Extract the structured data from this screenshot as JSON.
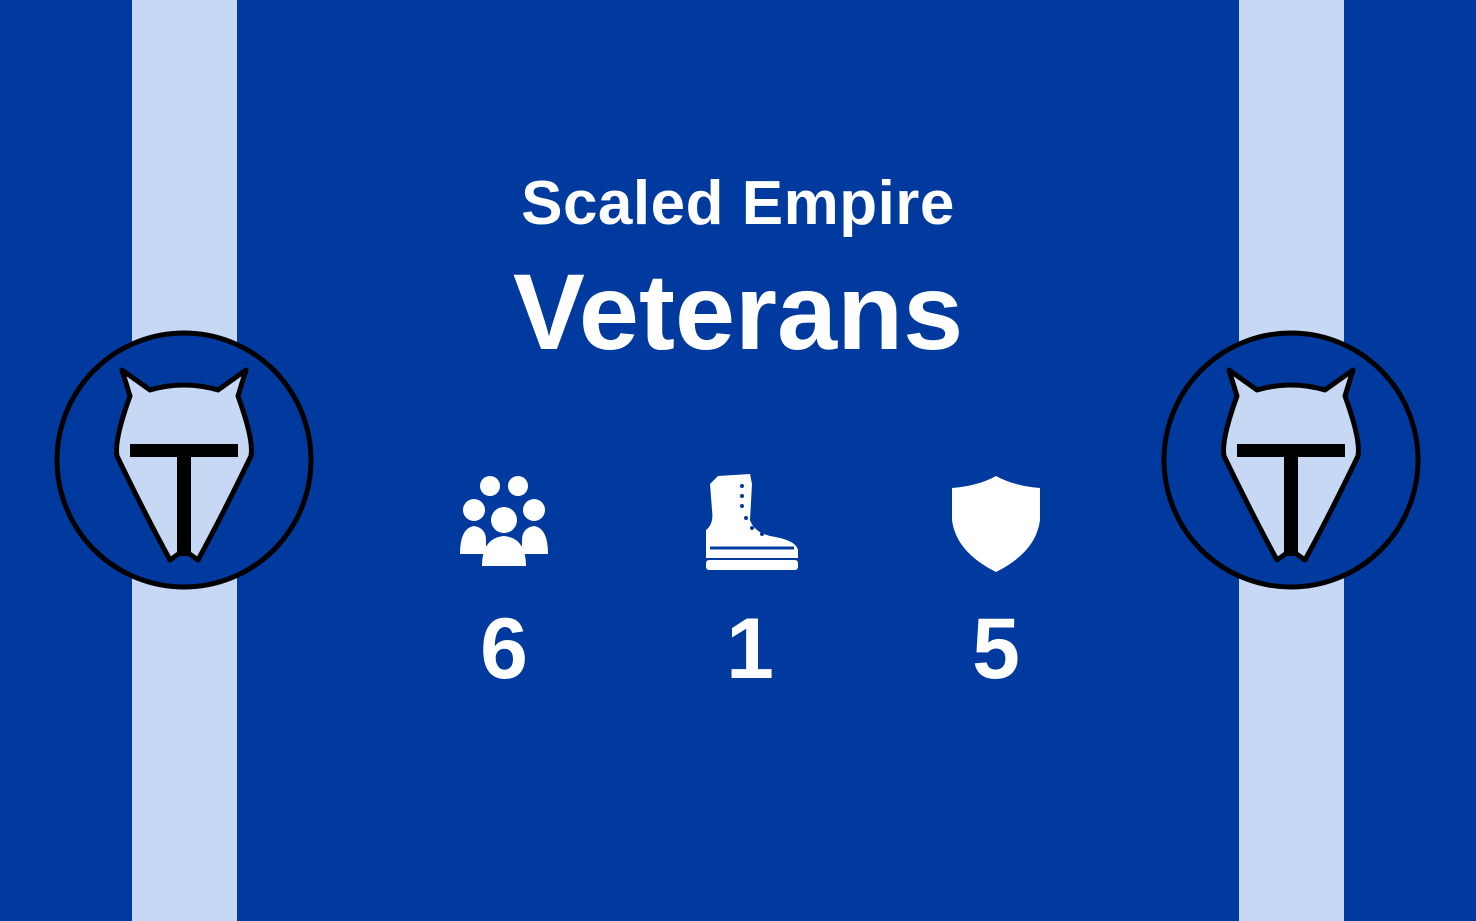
{
  "card": {
    "faction": "Scaled Empire",
    "unit_name": "Veterans"
  },
  "emblems": {
    "left": "helmet-emblem-icon",
    "right": "helmet-emblem-icon"
  },
  "stats": [
    {
      "icon": "group-icon",
      "value": "6"
    },
    {
      "icon": "boot-icon",
      "value": "1"
    },
    {
      "icon": "shield-icon",
      "value": "5"
    }
  ],
  "colors": {
    "background": "#003a9e",
    "stripe": "#c7d8f5",
    "text": "#ffffff",
    "emblem_outline": "#000000",
    "emblem_fill": "#c7d8f5"
  }
}
